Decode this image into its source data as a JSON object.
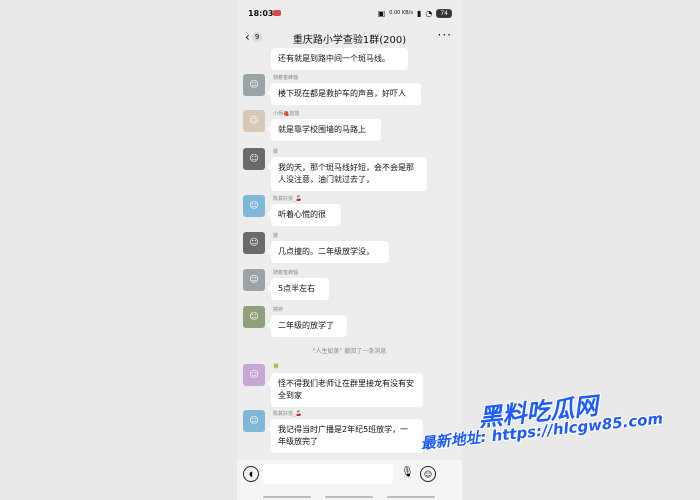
{
  "status_bar": {
    "time": "18:03",
    "net_speed": "0.00 KB/s",
    "battery": "74"
  },
  "chat_header": {
    "back_badge": "9",
    "title": "重庆路小学查验1群(200)",
    "more": "···"
  },
  "messages": [
    {
      "name": "",
      "text": "还有就是到路中间一个斑马线。"
    },
    {
      "name": "骑着蜜蜂轴",
      "text": "楼下现在都是救护车的声音，好吓人"
    },
    {
      "name": "小杨🍓悠悠",
      "text": "就是靠学校围墙的马路上"
    },
    {
      "name": "媛",
      "text": "我的天，那个斑马线好短，会不会是那人没注意，油门就过去了，"
    },
    {
      "name": "陈其好悦_🍒",
      "text": "听着心慌的很"
    },
    {
      "name": "媛",
      "text": "几点撞的。二年级放学没，"
    },
    {
      "name": "骑着蜜蜂轴",
      "text": "5点半左右"
    },
    {
      "name": "婷婷",
      "text": "二年级的放学了"
    },
    {
      "name": "🍀",
      "text": "怪不得我们老师让在群里接龙有没有安全到家"
    },
    {
      "name": "陈其好悦_🍒",
      "text": "我记得当时广播是2年纪5班放学，一年级放完了"
    }
  ],
  "system_notice": "\"人生如美\" 撤回了一条消息",
  "input_bar": {
    "voice_icon": "voice-icon",
    "mic_icon": "mic-icon",
    "emoji_icon": "emoji-icon"
  },
  "watermark": {
    "line1": "黑料吃瓜网",
    "line2": "最新地址: https://hlcgw85.com"
  }
}
